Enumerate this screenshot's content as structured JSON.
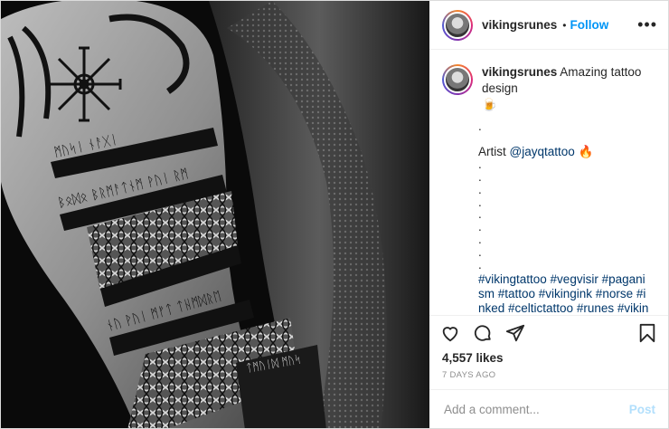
{
  "header": {
    "username": "vikingsrunes",
    "separator": "•",
    "follow_label": "Follow",
    "more_label": "•••"
  },
  "caption": {
    "username": "vikingsrunes",
    "text": "Amazing tattoo design",
    "emoji_1": "🍺",
    "lead_dot": ".",
    "artist_prefix": "Artist",
    "artist_handle": "@jayqtattoo",
    "emoji_2": "🔥",
    "spacer_dots": [
      ".",
      ".",
      ".",
      ".",
      ".",
      ".",
      ".",
      ".",
      "."
    ],
    "hashtags": "#vikingtattoo #vegvisir #paganism #tattoo #vikingink #norse #inked #celtictattoo #runes #vikings #valknut #valkyre #pagan #vikingart #mjolnir #viking #n"
  },
  "photo": {
    "rune_rows": [
      "ᛗᚢᛋᛁ ᚾᚨᚷᛁ",
      "ᛒᛟᛞᛟ ᛒᚱᛗᚨᛏᚾᛗ ᚹᚢᛁ ᚱᛗ",
      "ᚾᚢ ᚹᚢᛁ ᛗᚠᛏ ᛏᚺᛗᛞᚱᛖ",
      "ᛏᛗᚢᛁᛞ ᛗᚢᛋ"
    ]
  },
  "stats": {
    "likes": "4,557 likes",
    "age": "7 DAYS AGO"
  },
  "comment": {
    "placeholder": "Add a comment...",
    "post_label": "Post"
  },
  "icons": {
    "like": "heart-icon",
    "comment": "comment-icon",
    "share": "share-icon",
    "save": "bookmark-icon"
  }
}
